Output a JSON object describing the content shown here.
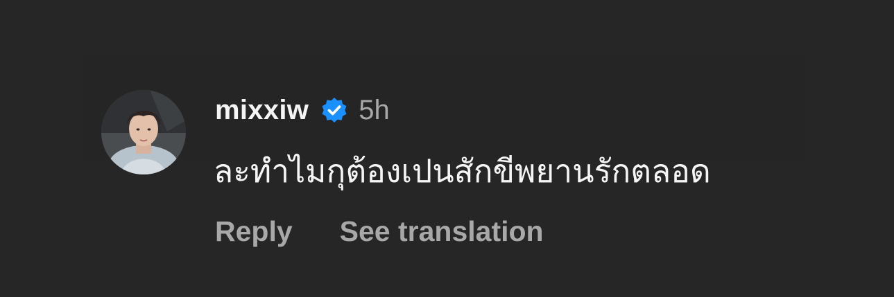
{
  "comment": {
    "username": "mixxiw",
    "verified_icon": "verified-badge-icon",
    "time": "5h",
    "text": "ละทำไมกุต้องเปนสักขีพยานรักตลอด",
    "avatar_icon": "user-avatar",
    "actions": {
      "reply": "Reply",
      "see_translation": "See translation"
    }
  },
  "colors": {
    "background": "#262626",
    "text_primary": "#f5f5f5",
    "text_secondary": "#a8a8a8",
    "verified_blue": "#1a90ff"
  }
}
